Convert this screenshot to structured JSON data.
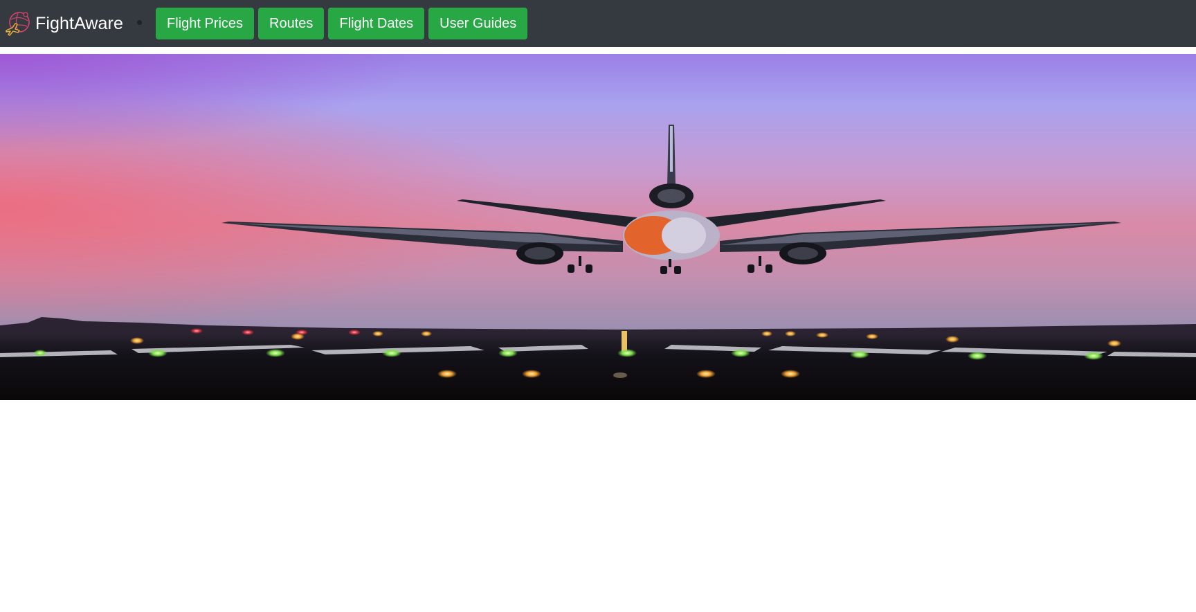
{
  "app": {
    "brand_name": "FightAware",
    "brand_icon": "globe-plane-logo-icon"
  },
  "nav": {
    "buttons": [
      {
        "label": "Flight Prices"
      },
      {
        "label": "Routes"
      },
      {
        "label": "Flight Dates"
      },
      {
        "label": "User Guides"
      }
    ]
  },
  "hero": {
    "image_subject": "airplane-landing-at-dusk-image"
  },
  "colors": {
    "navbar_bg": "#343a40",
    "button_green": "#28a745",
    "text_white": "#ffffff"
  }
}
